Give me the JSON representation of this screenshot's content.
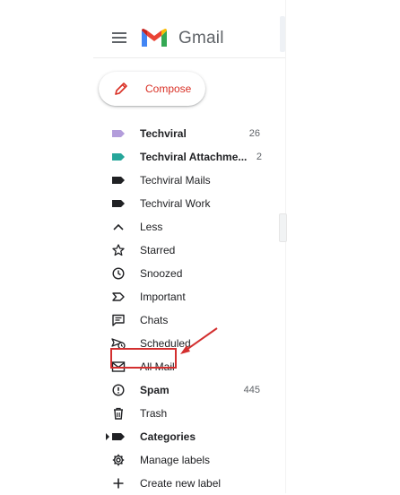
{
  "app": {
    "name": "Gmail"
  },
  "compose": {
    "label": "Compose"
  },
  "labels": [
    {
      "label": "Techviral",
      "count": "26",
      "bold": true,
      "color": "#b39ddb"
    },
    {
      "label": "Techviral Attachme...",
      "count": "2",
      "bold": true,
      "color": "#26a69a"
    },
    {
      "label": "Techviral Mails",
      "count": "",
      "bold": false,
      "color": "#202124"
    },
    {
      "label": "Techviral Work",
      "count": "",
      "bold": false,
      "color": "#202124"
    }
  ],
  "nav": {
    "less": "Less",
    "starred": "Starred",
    "snoozed": "Snoozed",
    "important": "Important",
    "chats": "Chats",
    "scheduled": "Scheduled",
    "all_mail": "All Mail",
    "spam": "Spam",
    "spam_count": "445",
    "trash": "Trash",
    "categories": "Categories",
    "manage_labels": "Manage labels",
    "create_label": "Create new label"
  },
  "colors": {
    "accent": "#d93025",
    "highlight_box": "#d32f2f",
    "icon": "#202124"
  }
}
